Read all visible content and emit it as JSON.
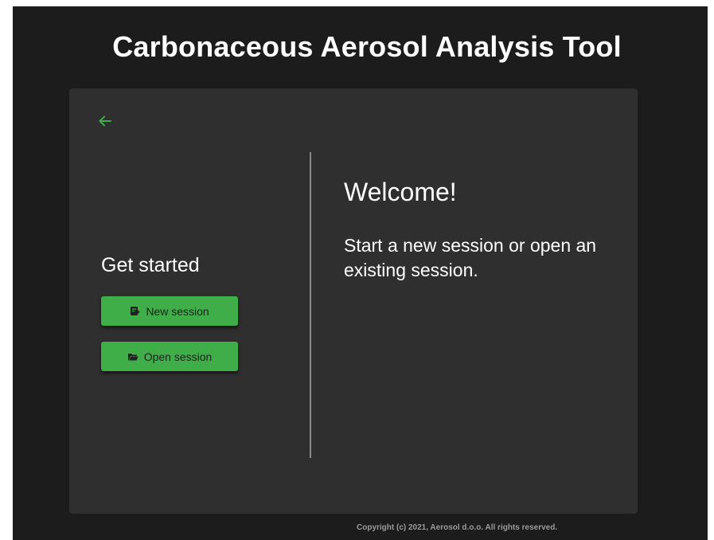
{
  "app": {
    "title": "Carbonaceous Aerosol Analysis Tool"
  },
  "sidebar": {
    "heading": "Get started",
    "buttons": {
      "new_session": "New session",
      "open_session": "Open session"
    }
  },
  "main": {
    "welcome_title": "Welcome!",
    "welcome_text": "Start a new session or open an existing session."
  },
  "footer": {
    "copyright": "Copyright (c) 2021, Aerosol d.o.o. All rights reserved."
  },
  "icons": {
    "back": "arrow-left-icon",
    "new_session": "new-document-icon",
    "open_session": "folder-open-icon"
  },
  "colors": {
    "accent": "#3fae49",
    "background": "#1c1c1c",
    "card": "#2f2f2f",
    "text": "#ffffff"
  }
}
